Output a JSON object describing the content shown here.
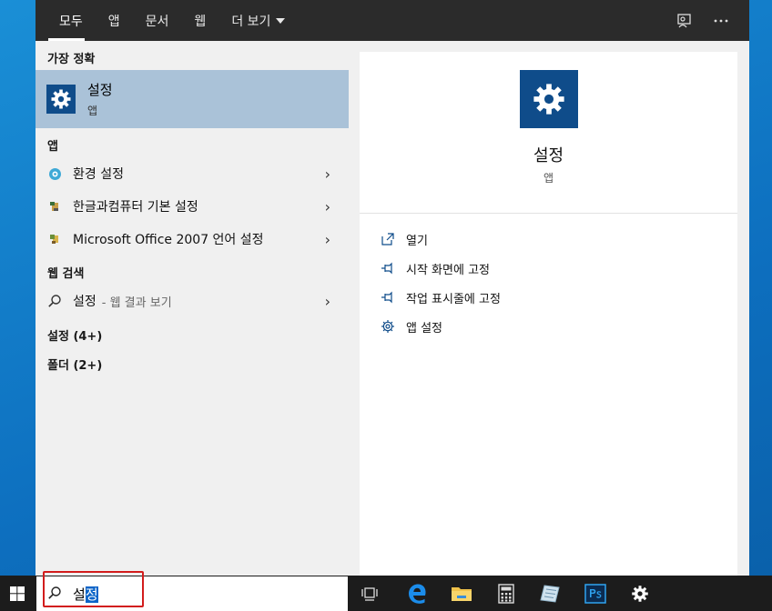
{
  "tabs": [
    "모두",
    "앱",
    "문서",
    "웹",
    "더 보기"
  ],
  "best_match": {
    "title": "가장 정확",
    "name": "설정",
    "type": "앱"
  },
  "apps": {
    "title": "앱",
    "items": [
      "환경 설정",
      "한글과컴퓨터 기본 설정",
      "Microsoft Office 2007 언어 설정"
    ]
  },
  "web": {
    "title": "웹 검색",
    "query": "설정",
    "hint": "- 웹 결과 보기"
  },
  "groups": [
    "설정 (4+)",
    "폴더 (2+)"
  ],
  "detail": {
    "name": "설정",
    "type": "앱",
    "actions": [
      "열기",
      "시작 화면에 고정",
      "작업 표시줄에 고정",
      "앱 설정"
    ]
  },
  "search": {
    "text_plain": "설",
    "text_selected": "정"
  },
  "colors": {
    "accent": "#0f4c8a",
    "highlight": "#aac2d8",
    "search_box_outline": "#d21c1c"
  }
}
